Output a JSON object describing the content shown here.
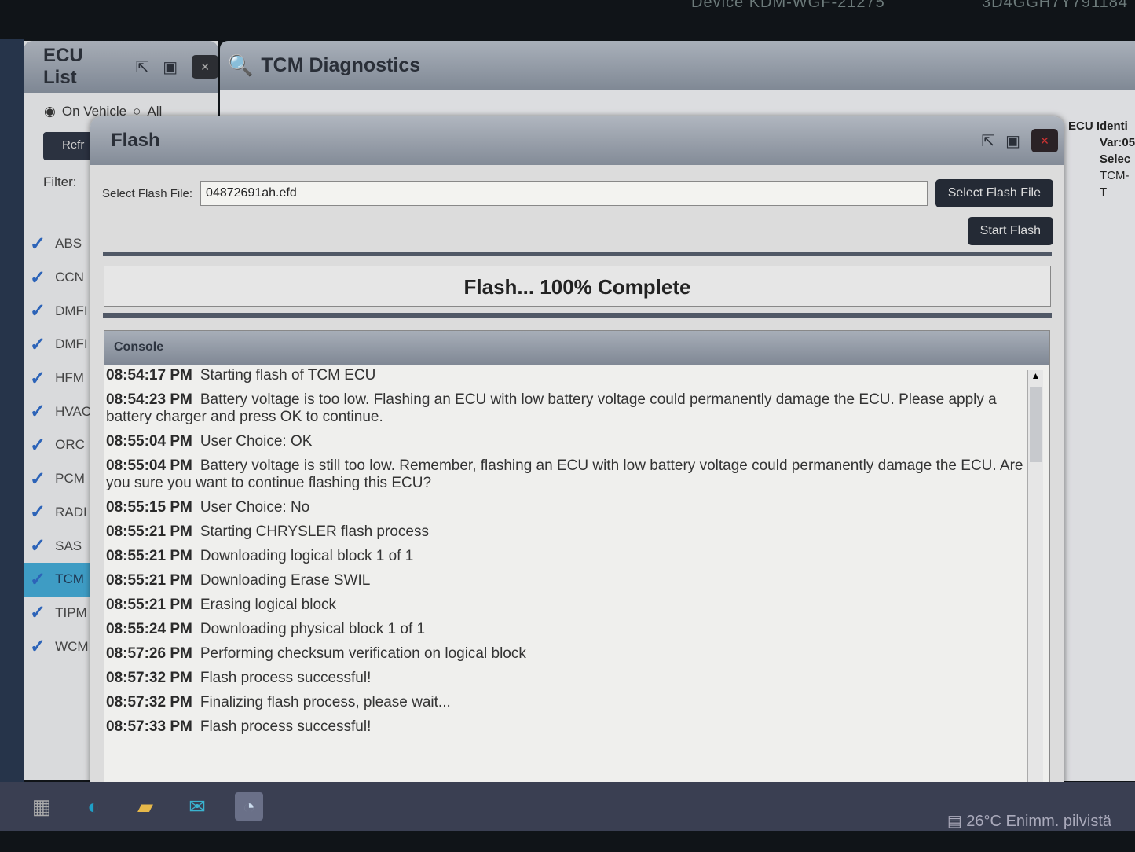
{
  "bezel": {
    "left": "Device KDM-WGF-21275",
    "right": "3D4GGH7Y791184"
  },
  "ecu_list": {
    "title": "ECU List",
    "radio_on": "On Vehicle",
    "radio_all": "All",
    "refresh": "Refr",
    "filter": "Filter:",
    "items": [
      {
        "label": "ABS"
      },
      {
        "label": "CCN"
      },
      {
        "label": "DMFI"
      },
      {
        "label": "DMFI"
      },
      {
        "label": "HFM"
      },
      {
        "label": "HVAC"
      },
      {
        "label": "ORC"
      },
      {
        "label": "PCM"
      },
      {
        "label": "RADI"
      },
      {
        "label": "SAS"
      },
      {
        "label": "TCM",
        "selected": true
      },
      {
        "label": "TIPM"
      },
      {
        "label": "WCM"
      }
    ]
  },
  "diag": {
    "title": "TCM Diagnostics",
    "info": [
      "ECU Identi",
      "Var:05",
      "Selec",
      "TCM-T"
    ]
  },
  "flash": {
    "title": "Flash",
    "file_label": "Select Flash File:",
    "file_value": "04872691ah.efd",
    "select_btn": "Select Flash File",
    "start_btn": "Start Flash",
    "status": "Flash... 100% Complete",
    "progress_percent": 100,
    "console_title": "Console",
    "logs": [
      {
        "time": "08:54:17 PM",
        "msg": "Starting flash of TCM ECU"
      },
      {
        "time": "08:54:23 PM",
        "msg": "Battery voltage is too low. Flashing an ECU with low battery voltage could permanently damage the ECU. Please apply a battery charger and press OK to continue."
      },
      {
        "time": "08:55:04 PM",
        "msg": "User Choice: OK"
      },
      {
        "time": "08:55:04 PM",
        "msg": "Battery voltage is still too low. Remember, flashing an ECU with low battery voltage could permanently damage the ECU.  Are you sure you want to continue flashing this ECU?"
      },
      {
        "time": "08:55:15 PM",
        "msg": "User Choice: No"
      },
      {
        "time": "08:55:21 PM",
        "msg": "Starting CHRYSLER flash process"
      },
      {
        "time": "08:55:21 PM",
        "msg": "Downloading logical block 1 of 1"
      },
      {
        "time": "08:55:21 PM",
        "msg": "Downloading Erase SWIL"
      },
      {
        "time": "08:55:21 PM",
        "msg": "Erasing logical block"
      },
      {
        "time": "08:55:24 PM",
        "msg": "Downloading physical block 1 of 1"
      },
      {
        "time": "08:57:26 PM",
        "msg": "Performing checksum verification on logical block"
      },
      {
        "time": "08:57:32 PM",
        "msg": "Flash process successful!"
      },
      {
        "time": "08:57:32 PM",
        "msg": "Finalizing flash process, please wait..."
      },
      {
        "time": "08:57:33 PM",
        "msg": "Flash process successful!"
      }
    ]
  },
  "taskbar": {
    "weather": "26°C  Enimm. pilvistä",
    "icons": [
      "task-view-icon",
      "edge-icon",
      "file-explorer-icon",
      "mail-icon",
      "diagnostic-app-icon"
    ]
  }
}
